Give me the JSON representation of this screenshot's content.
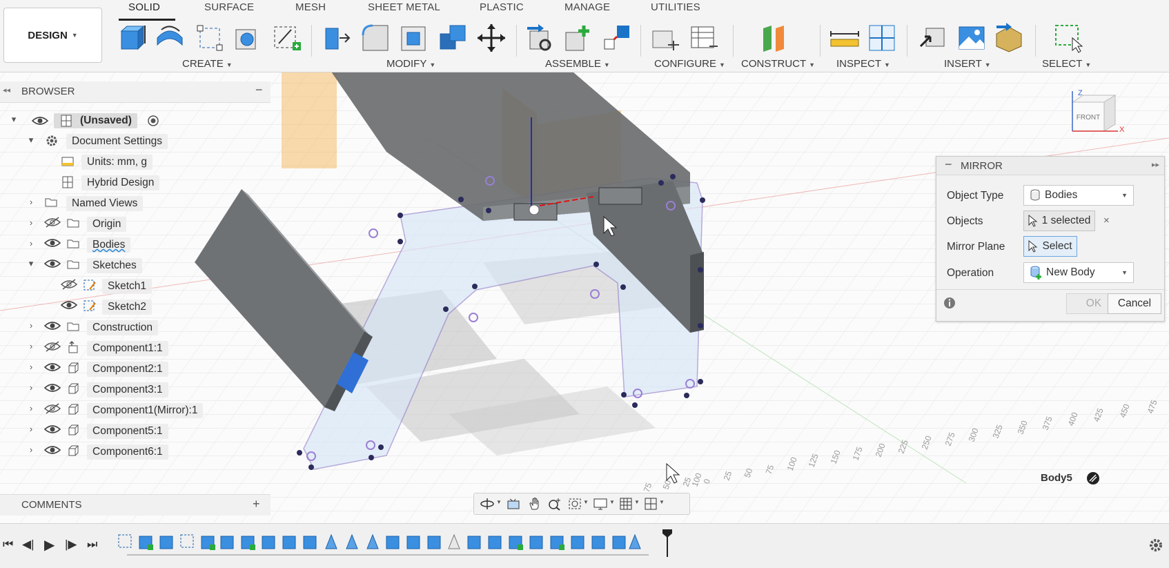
{
  "ribbon": {
    "design_label": "DESIGN",
    "tabs": [
      "SOLID",
      "SURFACE",
      "MESH",
      "SHEET METAL",
      "PLASTIC",
      "MANAGE",
      "UTILITIES"
    ],
    "groups": [
      "CREATE",
      "MODIFY",
      "ASSEMBLE",
      "CONFIGURE",
      "CONSTRUCT",
      "INSPECT",
      "INSERT",
      "SELECT"
    ]
  },
  "browser": {
    "title": "BROWSER",
    "items": [
      {
        "label": "(Unsaved)",
        "icon": "document-icon",
        "visible": true
      },
      {
        "label": "Document Settings",
        "icon": "gear-icon"
      },
      {
        "label": "Units: mm, g",
        "icon": "units-icon"
      },
      {
        "label": "Hybrid Design",
        "icon": "hybrid-design-icon"
      },
      {
        "label": "Named Views",
        "icon": "folder-icon"
      },
      {
        "label": "Origin",
        "icon": "folder-icon",
        "visible": false
      },
      {
        "label": "Bodies",
        "icon": "folder-icon",
        "visible": true
      },
      {
        "label": "Sketches",
        "icon": "folder-icon",
        "visible": true
      },
      {
        "label": "Sketch1",
        "icon": "sketch-icon",
        "visible": false
      },
      {
        "label": "Sketch2",
        "icon": "sketch-icon",
        "visible": true
      },
      {
        "label": "Construction",
        "icon": "folder-icon",
        "visible": true
      },
      {
        "label": "Component1:1",
        "icon": "component-icon",
        "visible": false
      },
      {
        "label": "Component2:1",
        "icon": "component-icon",
        "visible": true
      },
      {
        "label": "Component3:1",
        "icon": "component-icon",
        "visible": true
      },
      {
        "label": "Component1(Mirror):1",
        "icon": "component-icon",
        "visible": false
      },
      {
        "label": "Component5:1",
        "icon": "component-icon",
        "visible": true
      },
      {
        "label": "Component6:1",
        "icon": "component-icon",
        "visible": true
      }
    ]
  },
  "mirror": {
    "title": "MIRROR",
    "object_type_label": "Object Type",
    "object_type_value": "Bodies",
    "objects_label": "Objects",
    "objects_value": "1 selected",
    "mirror_plane_label": "Mirror Plane",
    "mirror_plane_value": "Select",
    "operation_label": "Operation",
    "operation_value": "New Body",
    "ok_label": "OK",
    "cancel_label": "Cancel"
  },
  "viewcube": {
    "face_label": "FRONT",
    "axis_z": "Z",
    "axis_x": "X"
  },
  "comments": {
    "title": "COMMENTS"
  },
  "status": {
    "selection": "Body5"
  },
  "ruler_ticks": [
    "475",
    "450",
    "425",
    "400",
    "375",
    "350",
    "325",
    "300",
    "275",
    "250",
    "225",
    "200",
    "175",
    "150",
    "125",
    "100",
    "75",
    "50",
    "25",
    "0",
    "25",
    "50",
    "75",
    "100"
  ],
  "colors": {
    "accent_blue": "#1a73c7",
    "body_gray": "#5f6366",
    "plane_orange": "#f5a623",
    "sketch_purple": "#8e72c8",
    "selected_blue": "#2f6fd6"
  }
}
